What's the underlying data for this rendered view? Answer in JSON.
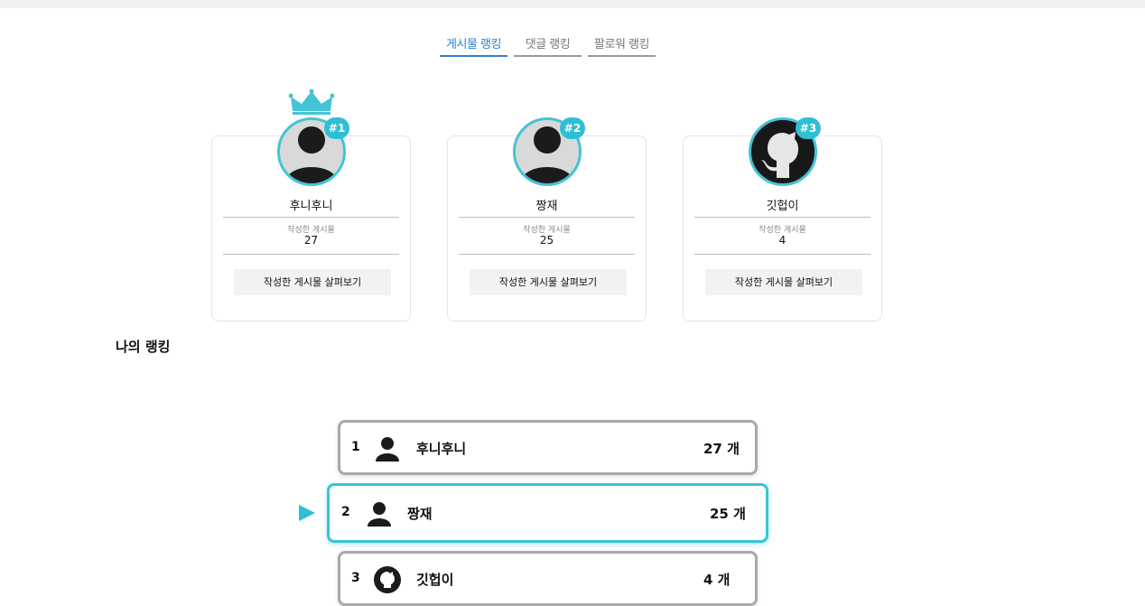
{
  "tabs": [
    {
      "label": "게시물 랭킹",
      "active": true
    },
    {
      "label": "댓글 랭킹",
      "active": false
    },
    {
      "label": "팔로워 랭킹",
      "active": false
    }
  ],
  "top_ranks": [
    {
      "badge": "#1",
      "name": "후니후니",
      "stat_label": "작성한 게시물",
      "stat_value": "27",
      "button": "작성한 게시물 살펴보기",
      "avatar": "person-icon"
    },
    {
      "badge": "#2",
      "name": "짱재",
      "stat_label": "작성한 게시물",
      "stat_value": "25",
      "button": "작성한 게시물 살펴보기",
      "avatar": "person-icon"
    },
    {
      "badge": "#3",
      "name": "깃헙이",
      "stat_label": "작성한 게시물",
      "stat_value": "4",
      "button": "작성한 게시물 살펴보기",
      "avatar": "github-icon"
    }
  ],
  "my_ranking": {
    "title": "나의 랭킹",
    "rows": [
      {
        "rank": "1",
        "name": "후니후니",
        "count": "27 개",
        "icon": "person-icon"
      },
      {
        "rank": "2",
        "name": "짱재",
        "count": "25 개",
        "icon": "person-icon",
        "current_user": true
      },
      {
        "rank": "3",
        "name": "깃헙이",
        "count": "4 개",
        "icon": "github-icon"
      }
    ]
  },
  "colors": {
    "accent": "#2fbfd4",
    "tab_active": "#2b7fce",
    "row_border": "#a9a9a9"
  }
}
